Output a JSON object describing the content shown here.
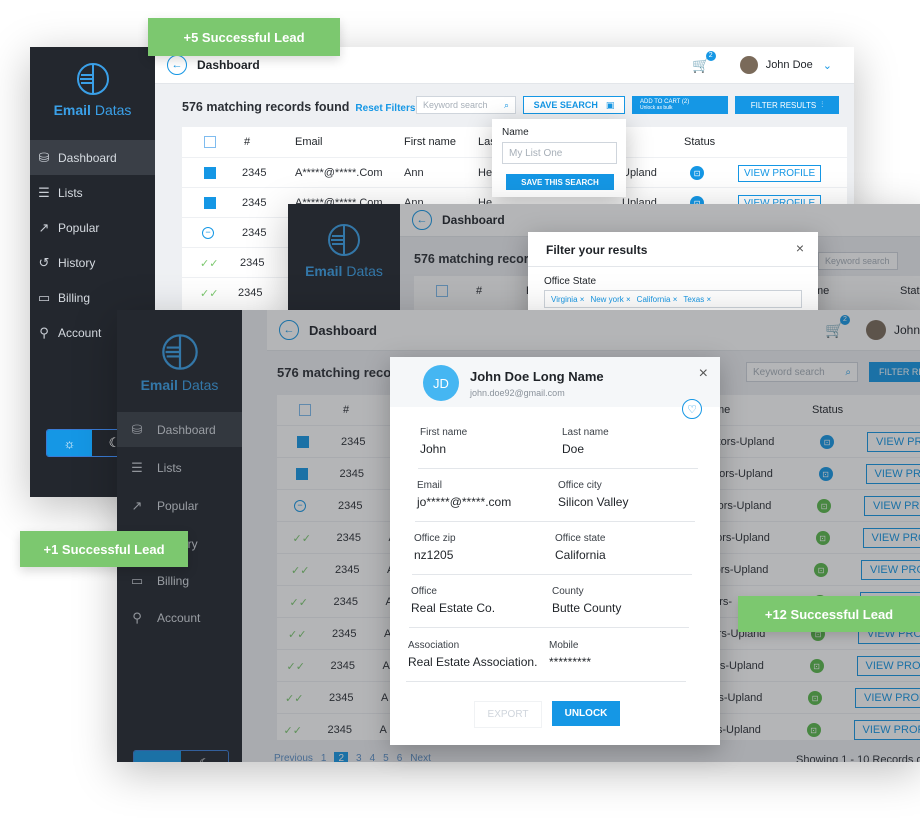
{
  "app": {
    "brand_bold": "Email",
    "brand_light": " Datas",
    "page_title": "Dashboard",
    "user_name": "John Doe",
    "cart_badge": "2"
  },
  "nav": [
    {
      "icon": "database-icon",
      "label": "Dashboard"
    },
    {
      "icon": "list-icon",
      "label": "Lists"
    },
    {
      "icon": "trend-icon",
      "label": "Popular"
    },
    {
      "icon": "history-icon",
      "label": "History"
    },
    {
      "icon": "billing-icon",
      "label": "Billing"
    },
    {
      "icon": "user-icon",
      "label": "Account"
    }
  ],
  "toolbar": {
    "matching": "576 matching records found",
    "reset": "Reset Filters",
    "keyword_placeholder": "Keyword search",
    "save_search": "SAVE SEARCH",
    "add_to_cart": "ADD TO CART (2)",
    "add_to_cart_sub": "Unlock as bulk",
    "filter_results": "FILTER RESULTS",
    "matching_short": "576 matching records f"
  },
  "table": {
    "headers": {
      "num": "#",
      "email": "Email",
      "first": "First name",
      "last": "Las",
      "name": "me",
      "status": "Status"
    },
    "back_rows": [
      {
        "num": "2345",
        "email": "A*****@*****.Com",
        "first": "Ann",
        "last": "He",
        "assoc": "Upland"
      },
      {
        "num": "2345",
        "email": "A*****@*****.Com",
        "first": "Ann",
        "last": "He",
        "assoc": "Upland"
      },
      {
        "num": "2345"
      },
      {
        "num": "2345"
      },
      {
        "num": "2345"
      }
    ],
    "front_rows": [
      {
        "num": "2345",
        "email_start": "A",
        "assoc": "altors-Upland"
      },
      {
        "num": "2345",
        "email_start": "A",
        "assoc": "altors-Upland"
      },
      {
        "num": "2345",
        "email_start": "A",
        "assoc": "altors-Upland"
      },
      {
        "num": "2345",
        "email_start": "A",
        "assoc": "altors-Upland"
      },
      {
        "num": "2345",
        "email_start": "A",
        "assoc": "altors-Upland"
      },
      {
        "num": "2345",
        "email_start": "A",
        "assoc": "altors-"
      },
      {
        "num": "2345",
        "email_start": "A",
        "assoc": "altors-Upland"
      },
      {
        "num": "2345",
        "email_start": "A",
        "assoc": "altors-Upland"
      },
      {
        "num": "2345",
        "email_start": "A",
        "assoc": "altors-Upland"
      },
      {
        "num": "2345",
        "email_start": "A",
        "assoc": "altors-Upland"
      }
    ],
    "view_profile": "VIEW PROFILE",
    "view_profile_cut": "VIEW PRO",
    "view_profile_cut2": "VIEW PROFI",
    "header_name": "me",
    "header_email_cut": "E",
    "header_email_cut2": "Er"
  },
  "save_popup": {
    "label": "Name",
    "placeholder": "My List One",
    "button": "SAVE THIS SEARCH"
  },
  "filter_modal": {
    "title": "Filter your results",
    "section": "Office State",
    "chips": [
      "Virginia ×",
      "New york ×",
      "California ×",
      "Texas ×"
    ]
  },
  "profile": {
    "initials": "JD",
    "name": "John Doe Long Name",
    "email": "john.doe92@gmail.com",
    "fields": [
      {
        "label": "First name",
        "value": "John"
      },
      {
        "label": "Last name",
        "value": "Doe"
      },
      {
        "label": "Email",
        "value": "jo*****@*****.com"
      },
      {
        "label": "Office city",
        "value": "Silicon Valley"
      },
      {
        "label": "Office zip",
        "value": "nz1205"
      },
      {
        "label": "Office state",
        "value": "California"
      },
      {
        "label": "Office",
        "value": "Real Estate Co."
      },
      {
        "label": "County",
        "value": "Butte County"
      },
      {
        "label": "Association",
        "value": "Real Estate Association."
      },
      {
        "label": "Mobile",
        "value": "*********"
      }
    ],
    "export": "EXPORT",
    "unlock": "UNLOCK"
  },
  "pagination": {
    "previous": "Previous",
    "pages": [
      "1",
      "2",
      "3",
      "4",
      "5",
      "6"
    ],
    "current": "2",
    "next": "Next",
    "showing": "Showing 1 - 10 Records of"
  },
  "badges": {
    "lead5": "+5 Successful Lead",
    "lead1": "+1 Successful Lead",
    "lead12": "+12 Successful Lead"
  },
  "partial": {
    "history_cut": "ory",
    "user_cut": "John",
    "filter_cut": "FILTER RE",
    "status_cut": "Stat",
    "name_cut": "me"
  },
  "colors": {
    "accent": "#1597e5",
    "success": "#7cc86f",
    "sidebar": "#23272e"
  }
}
